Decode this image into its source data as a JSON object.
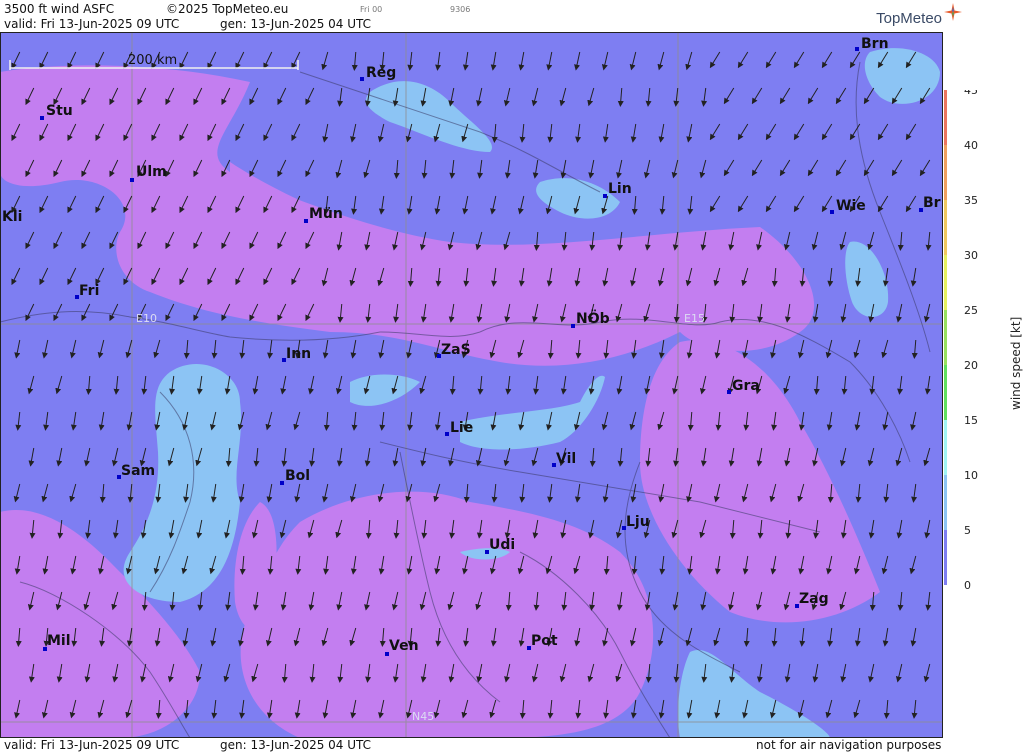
{
  "header": {
    "title": "3500 ft wind ASFC",
    "copyright": "©2025 TopMeteo.eu",
    "run_tag": "Fri 00",
    "code": "9306",
    "valid": "valid:  Fri  13-Jun-2025  09 UTC",
    "gen": "gen: 13-Jun-2025 04 UTC"
  },
  "logo": {
    "text": "TopMeteo"
  },
  "footer": {
    "valid": "valid:  Fri  13-Jun-2025  09 UTC",
    "gen": "gen: 13-Jun-2025 04 UTC",
    "disclaimer": "not for air navigation purposes"
  },
  "scale_bar": {
    "label": "200 km"
  },
  "grid_labels": {
    "e10": "E10",
    "e15": "E15",
    "n45": "N45"
  },
  "cities": [
    {
      "name": "Stu"
    },
    {
      "name": "Ulm"
    },
    {
      "name": "Reg"
    },
    {
      "name": "Brn"
    },
    {
      "name": "Kli"
    },
    {
      "name": "Mün"
    },
    {
      "name": "Lin"
    },
    {
      "name": "Wie"
    },
    {
      "name": "Br"
    },
    {
      "name": "Fri"
    },
    {
      "name": "NÖb"
    },
    {
      "name": "Inn"
    },
    {
      "name": "ZaS"
    },
    {
      "name": "Gra"
    },
    {
      "name": "Lie"
    },
    {
      "name": "Vil"
    },
    {
      "name": "Sam"
    },
    {
      "name": "Bol"
    },
    {
      "name": "Lju"
    },
    {
      "name": "Udi"
    },
    {
      "name": "Zag"
    },
    {
      "name": "Mil"
    },
    {
      "name": "Ven"
    },
    {
      "name": "Pot"
    }
  ],
  "colorbar": {
    "label": "wind  speed  [kt]",
    "ticks": [
      "45",
      "40",
      "35",
      "30",
      "25",
      "20",
      "15",
      "10",
      "5",
      "0"
    ],
    "colors": [
      "#ec7560",
      "#f0a060",
      "#f0c860",
      "#e6f060",
      "#98e060",
      "#60e060",
      "#a0f4f4",
      "#8cc4f4",
      "#7e7ef2",
      "#c37ef0"
    ]
  },
  "map_colors": {
    "calm_0_5": "#c37ef0",
    "light_5_10": "#7e7ef2",
    "moderate_10_15": "#8cc4f4"
  }
}
